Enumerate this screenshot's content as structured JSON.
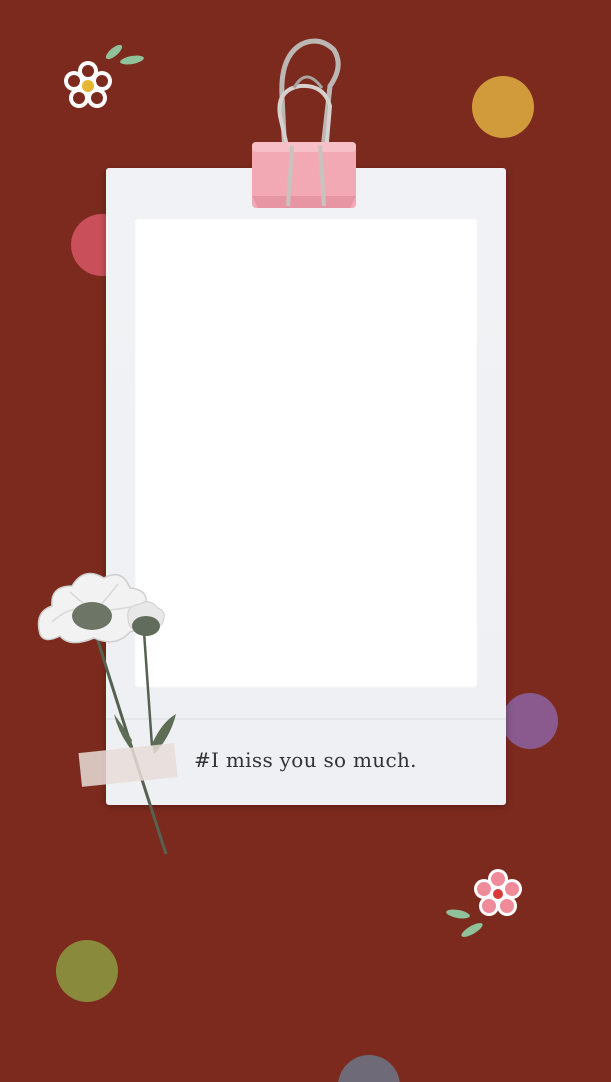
{
  "caption": {
    "text": "#I  miss  you so much."
  },
  "colors": {
    "background": "#7d2a1e",
    "dot_orange": "#d19a3a",
    "dot_pink": "#c94f5a",
    "dot_purple": "#8a5a8f",
    "dot_olive": "#8a8a3c",
    "dot_gray": "#6e6a78",
    "clip_pink": "#f2a9b4",
    "clip_metal": "#c9c3c0"
  },
  "icons": {
    "clip": "binder-clip-icon",
    "flower_sticker": "flower-icon",
    "pressed_flower": "pressed-flower-icon"
  }
}
